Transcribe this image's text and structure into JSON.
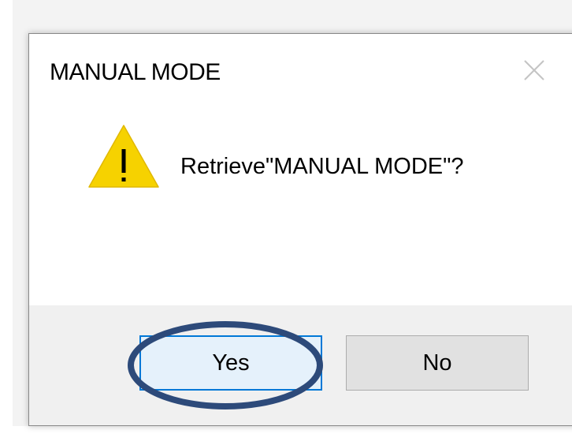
{
  "dialog": {
    "title": "MANUAL MODE",
    "message": "Retrieve\"MANUAL MODE\"?",
    "icon": "warning-icon",
    "close_icon": "close-icon",
    "buttons": {
      "yes_label": "Yes",
      "no_label": "No"
    },
    "default_button": "Yes"
  },
  "colors": {
    "warning_fill": "#f6d200",
    "focus_border": "#0078d7",
    "annotation_stroke": "#2d4a7a",
    "footer_bg": "#f0f0f0"
  }
}
